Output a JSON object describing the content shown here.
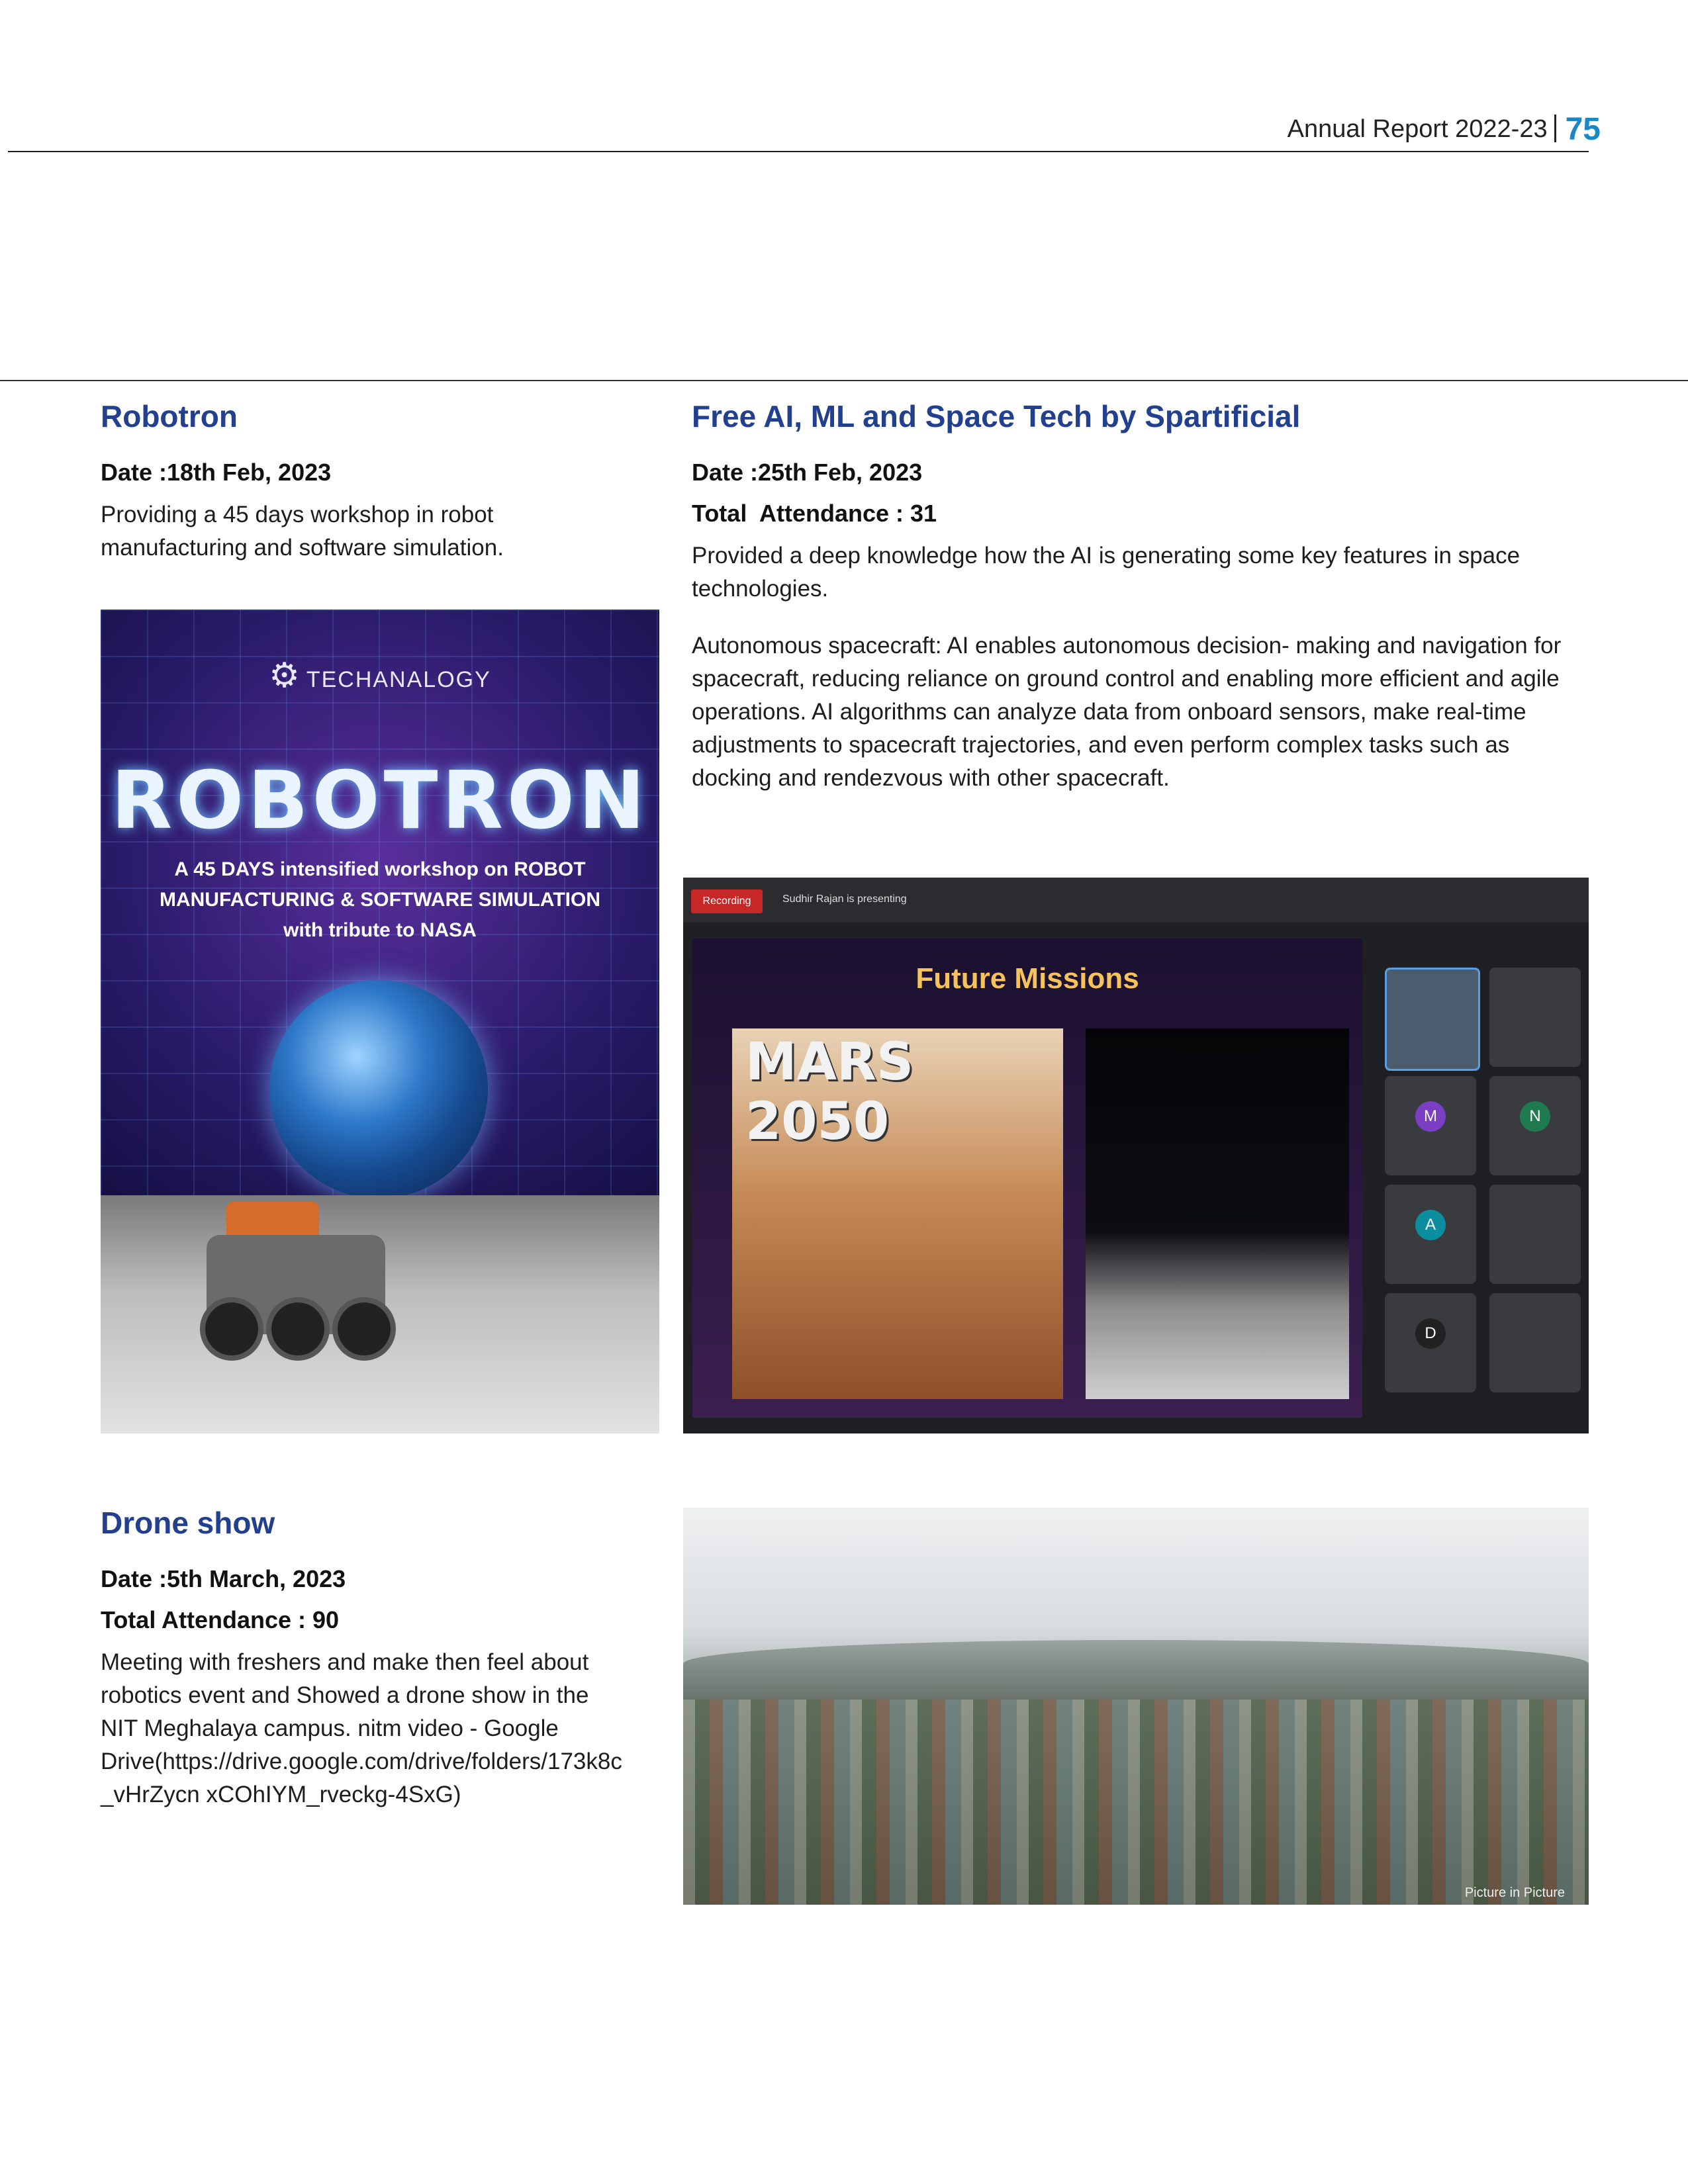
{
  "header": {
    "report_title": "Annual Report 2022-23",
    "page_number": "75"
  },
  "robotron": {
    "title": "Robotron",
    "date": "Date :18th Feb, 2023",
    "description": "Providing a 45 days workshop in robot manufacturing and software simulation.",
    "poster": {
      "brand": "TECHANALOGY",
      "title": "ROBOTRON",
      "subtitle": "A 45 DAYS intensified workshop on ROBOT MANUFACTURING & SOFTWARE SIMULATION with tribute to NASA"
    }
  },
  "spartificial": {
    "title": "Free AI, ML and Space Tech by Spartificial",
    "date": "Date :25th Feb, 2023",
    "attendance": "Total  Attendance : 31",
    "paragraph1": "Provided a deep knowledge how the AI is generating some key features in space technologies.",
    "paragraph2": "Autonomous spacecraft: AI enables autonomous decision- making and navigation for spacecraft, reducing reliance on ground control and enabling more efficient and agile operations. AI algorithms can analyze data from onboard sensors, make real-time adjustments to spacecraft trajectories, and even perform complex tasks such as docking and rendezvous with other spacecraft.",
    "meeting": {
      "recording_label": "Recording",
      "presenting_label": "Sudhir Rajan is presenting",
      "slide_title": "Future Missions",
      "slide_image_label": "MARS 2050",
      "participant_initials": [
        "M",
        "N",
        "A",
        "D"
      ]
    }
  },
  "drone_show": {
    "title": "Drone show",
    "date": "Date :5th March, 2023",
    "attendance": "Total Attendance : 90",
    "description": "Meeting with freshers and make then feel about robotics event and Showed a drone show in the NIT Meghalaya campus. nitm video - Google Drive(https://drive.google.com/drive/folders/173k8c_vHrZycn xCOhIYM_rveckg-4SxG)",
    "photo_overlay": "Picture in Picture"
  },
  "colors": {
    "heading": "#23408e",
    "page_number": "#1b87c6"
  }
}
